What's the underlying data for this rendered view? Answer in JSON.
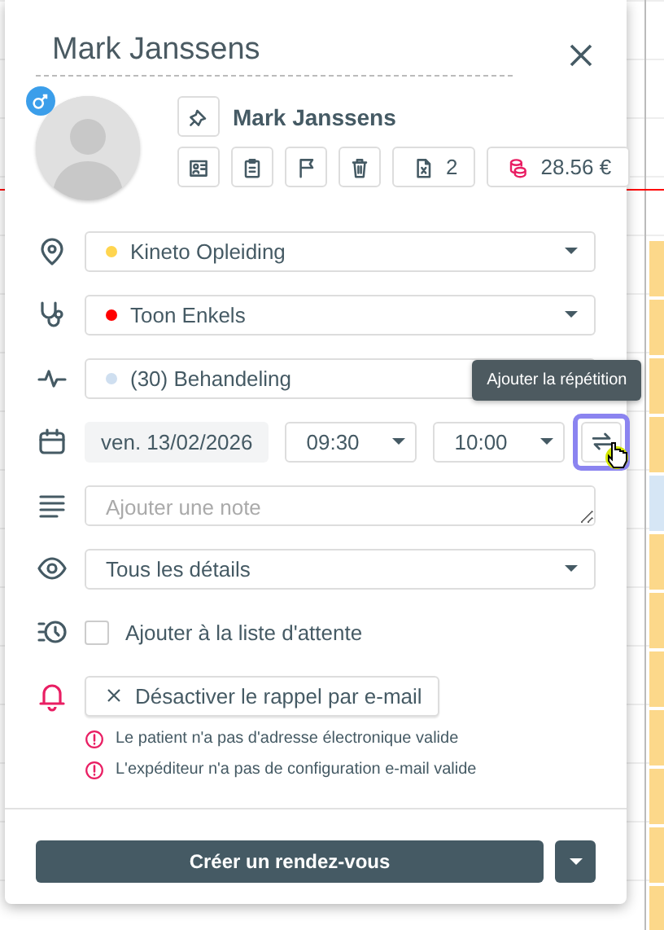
{
  "title": "Mark Janssens",
  "patient": {
    "name": "Mark Janssens"
  },
  "actions": [
    {
      "kind": "card"
    },
    {
      "kind": "clipboard"
    },
    {
      "kind": "flag"
    },
    {
      "kind": "trash"
    },
    {
      "kind": "documents",
      "count": "2"
    },
    {
      "kind": "balance",
      "amount": "28.56 €"
    }
  ],
  "location": {
    "value": "Kineto Opleiding",
    "color": "#ffd54f"
  },
  "practitioner": {
    "value": "Toon Enkels",
    "color": "#ff0000"
  },
  "treatment": {
    "value": "(30) Behandeling",
    "color": "#cfdff0"
  },
  "date": "ven. 13/02/2026",
  "start": "09:30",
  "end": "10:00",
  "repeat": {
    "tooltip": "Ajouter la répétition",
    "highlighted": true
  },
  "note": {
    "placeholder": "Ajouter une note"
  },
  "visibility": "Tous les détails",
  "waitlist": {
    "label": "Ajouter à la liste d'attente",
    "checked": false
  },
  "reminder": {
    "label": "Désactiver le rappel par e-mail"
  },
  "warnings": [
    "Le patient n'a pas d'adresse électronique valide",
    "L'expéditeur n'a pas de configuration e-mail valide"
  ],
  "create_button": "Créer un rendez-vous"
}
